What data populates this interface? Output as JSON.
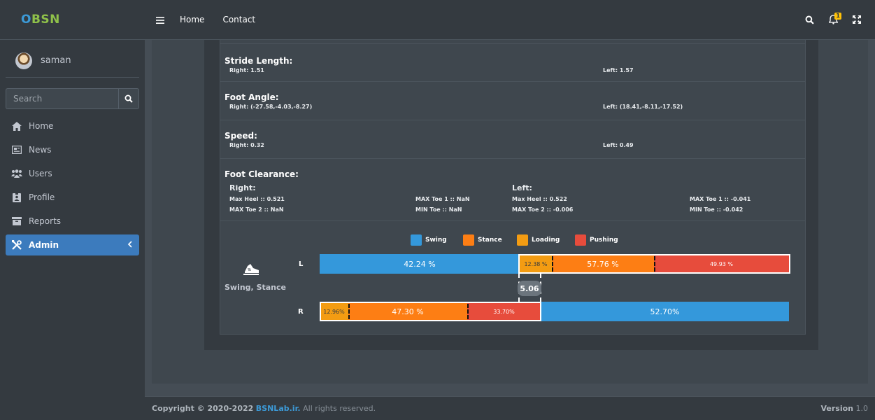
{
  "brand": {
    "name_part1": "O",
    "name_part2": "BSN"
  },
  "user": {
    "name": "saman"
  },
  "search": {
    "placeholder": "Search"
  },
  "sidebar": {
    "items": [
      {
        "label": "Home",
        "icon": "home-icon"
      },
      {
        "label": "News",
        "icon": "news-icon"
      },
      {
        "label": "Users",
        "icon": "users-icon"
      },
      {
        "label": "Profile",
        "icon": "profile-icon"
      },
      {
        "label": "Reports",
        "icon": "reports-icon"
      },
      {
        "label": "Admin",
        "icon": "tools-icon",
        "active": true
      }
    ]
  },
  "header": {
    "links": [
      "Home",
      "Contact"
    ],
    "notification_count": "1"
  },
  "stride_length": {
    "title": "Stride Length:",
    "right": "Right: 1.51",
    "left": "Left: 1.57"
  },
  "foot_angle": {
    "title": "Foot Angle:",
    "right": "Right: (-27.58,-4.03,-8.27)",
    "left": "Left: (18.41,-8.11,-17.52)"
  },
  "speed": {
    "title": "Speed:",
    "right": "Right: 0.32",
    "left": "Left: 0.49"
  },
  "foot_clearance": {
    "title": "Foot Clearance:",
    "right_label": "Right:",
    "left_label": "Left:",
    "right_max_heel": "Max Heel :: 0.521",
    "right_max_toe1": "MAX Toe 1 :: NaN",
    "right_max_toe2": "MAX Toe 2 :: NaN",
    "right_min_toe": "MIN Toe :: NaN",
    "left_max_heel": "Max Heel :: 0.522",
    "left_max_toe1": "MAX Toe 1 :: -0.041",
    "left_max_toe2": "MAX Toe 2 :: -0.006",
    "left_min_toe": "MIN Toe :: -0.042"
  },
  "gait_chart": {
    "label": "Swing, Stance",
    "legend": [
      {
        "name": "Swing",
        "color": "#3498db"
      },
      {
        "name": "Stance",
        "color": "#fd7e14"
      },
      {
        "name": "Loading",
        "color": "#f39c12"
      },
      {
        "name": "Pushing",
        "color": "#e74c3c"
      }
    ],
    "row_L": "L",
    "row_R": "R",
    "offset_value": "5.06"
  },
  "chart_data": {
    "type": "bar",
    "title": "",
    "series": [
      {
        "name": "L",
        "segments": [
          {
            "label": "42.24 %",
            "value": 42.24,
            "phase": "Swing"
          },
          {
            "label": "12.38 %",
            "value": 12.38,
            "phase": "Loading"
          },
          {
            "label": "57.76 %",
            "value": 57.76,
            "phase": "Stance"
          },
          {
            "label": "49.93 %",
            "value": 49.93,
            "phase": "Pushing"
          }
        ]
      },
      {
        "name": "R",
        "segments": [
          {
            "label": "12.96%",
            "value": 12.96,
            "phase": "Loading"
          },
          {
            "label": "47.30 %",
            "value": 47.3,
            "phase": "Stance"
          },
          {
            "label": "33.70%",
            "value": 33.7,
            "phase": "Pushing"
          },
          {
            "label": "52.70%",
            "value": 52.7,
            "phase": "Swing"
          }
        ]
      }
    ],
    "offset": 5.06
  },
  "footer": {
    "copyright": "Copyright © 2020-2022",
    "site": "BSNLab.ir.",
    "rights": "All rights reserved.",
    "version_label": "Version",
    "version": "1.0"
  },
  "colors": {
    "sidebar_bg": "#343a40",
    "content_bg": "#454d55",
    "accent": "#3c7bbd"
  }
}
